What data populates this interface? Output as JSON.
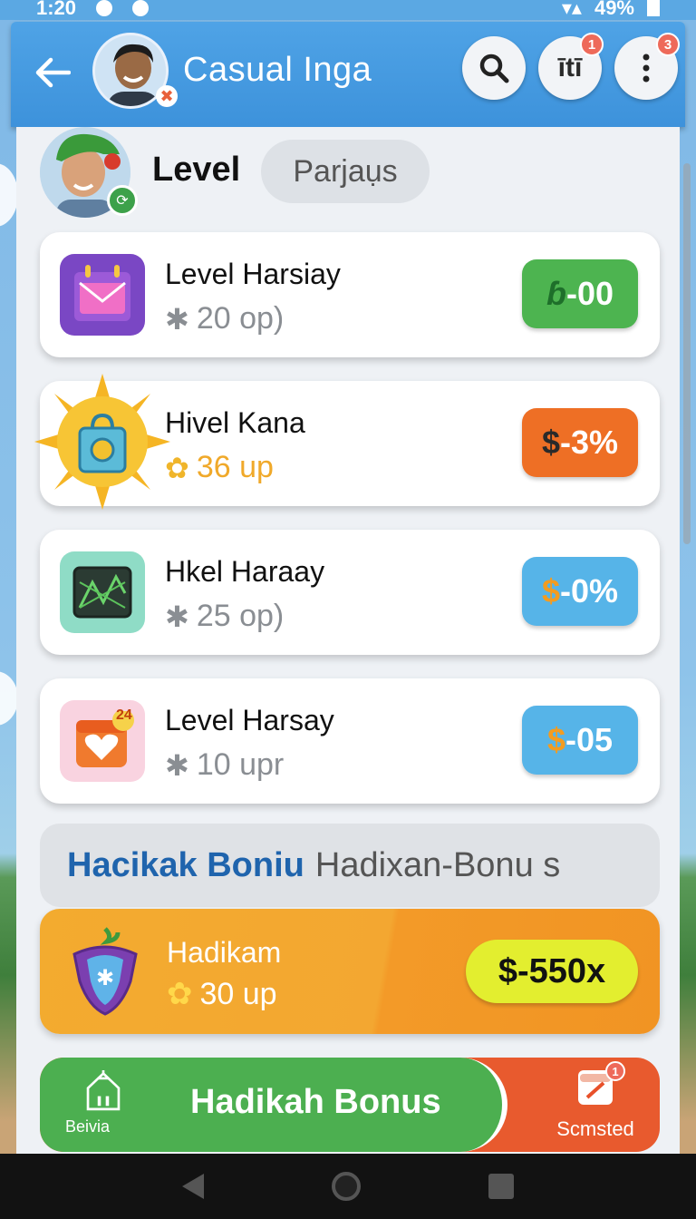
{
  "status_bar": {
    "time": "1:20",
    "battery": "49%"
  },
  "app_bar": {
    "title": "Casual Inga",
    "menu_badge": "3",
    "filter_badge": "1",
    "filter_label": "ītī",
    "avatar_badge": "✖"
  },
  "section": {
    "title": "Level",
    "chip": "Parjaụs"
  },
  "cards": [
    {
      "name": "Level Harsiay",
      "sub": "20 op)",
      "price_symbol": "ɓ",
      "price_value": "-00",
      "color": "#4db450"
    },
    {
      "name": "Hivel Kana",
      "sub": "36 up",
      "price_symbol": "$",
      "price_value": "-3%",
      "color": "#ee6f25"
    },
    {
      "name": "Hkel Haraay",
      "sub": "25 op)",
      "price_symbol": "$",
      "price_value": "-0%",
      "color": "#56b4e8"
    },
    {
      "name": "Level Harsay",
      "sub": "10 upr",
      "price_symbol": "$",
      "price_value": "-05",
      "color": "#56b4e8",
      "icon_badge": "24"
    }
  ],
  "bonus_header": {
    "bold": "Hacikak Boniu",
    "rest": "Hadixan-Bonu s"
  },
  "bonus_card": {
    "name": "Hadikam",
    "sub": "30 up",
    "price": "$-550x"
  },
  "bottom": {
    "home_label": "Beivia",
    "main_button": "Hadikah Bonus",
    "right_label": "Scmsted",
    "right_badge": "1"
  }
}
